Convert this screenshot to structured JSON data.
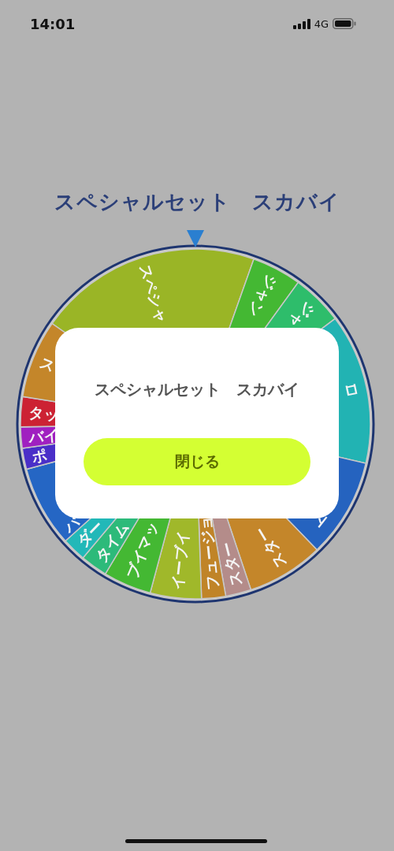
{
  "status_bar": {
    "time": "14:01",
    "network": "4G"
  },
  "title": "スペシャルセット　スカバイ",
  "wheel": {
    "segments": [
      {
        "label": "スペシャ",
        "color": "#9ab526"
      },
      {
        "label": "ジャン",
        "color": "#44b833"
      },
      {
        "label": "ジャ",
        "color": "#2ebd6b"
      },
      {
        "label": "ロ",
        "color": "#22b3b3"
      },
      {
        "label": "ト",
        "color": "#2563bf"
      },
      {
        "label": "スター",
        "color": "#c4862a"
      },
      {
        "label": "スター",
        "color": "#b48c8a"
      },
      {
        "label": "フュージョ",
        "color": "#c08428"
      },
      {
        "label": "イーブイ",
        "color": "#a0b82a"
      },
      {
        "label": "ブイマッ",
        "color": "#44b833"
      },
      {
        "label": "タイム",
        "color": "#2dba7a"
      },
      {
        "label": "ダー",
        "color": "#22b8b8"
      },
      {
        "label": "バ",
        "color": "#2566c4"
      },
      {
        "label": "ポ",
        "color": "#4a2fc8"
      },
      {
        "label": "バイ",
        "color": "#a020c0"
      },
      {
        "label": "タッ",
        "color": "#cc2233"
      },
      {
        "label": "ス",
        "color": "#c4862a"
      }
    ]
  },
  "dialog": {
    "message": "スペシャルセット　スカバイ",
    "button": "閉じる"
  }
}
